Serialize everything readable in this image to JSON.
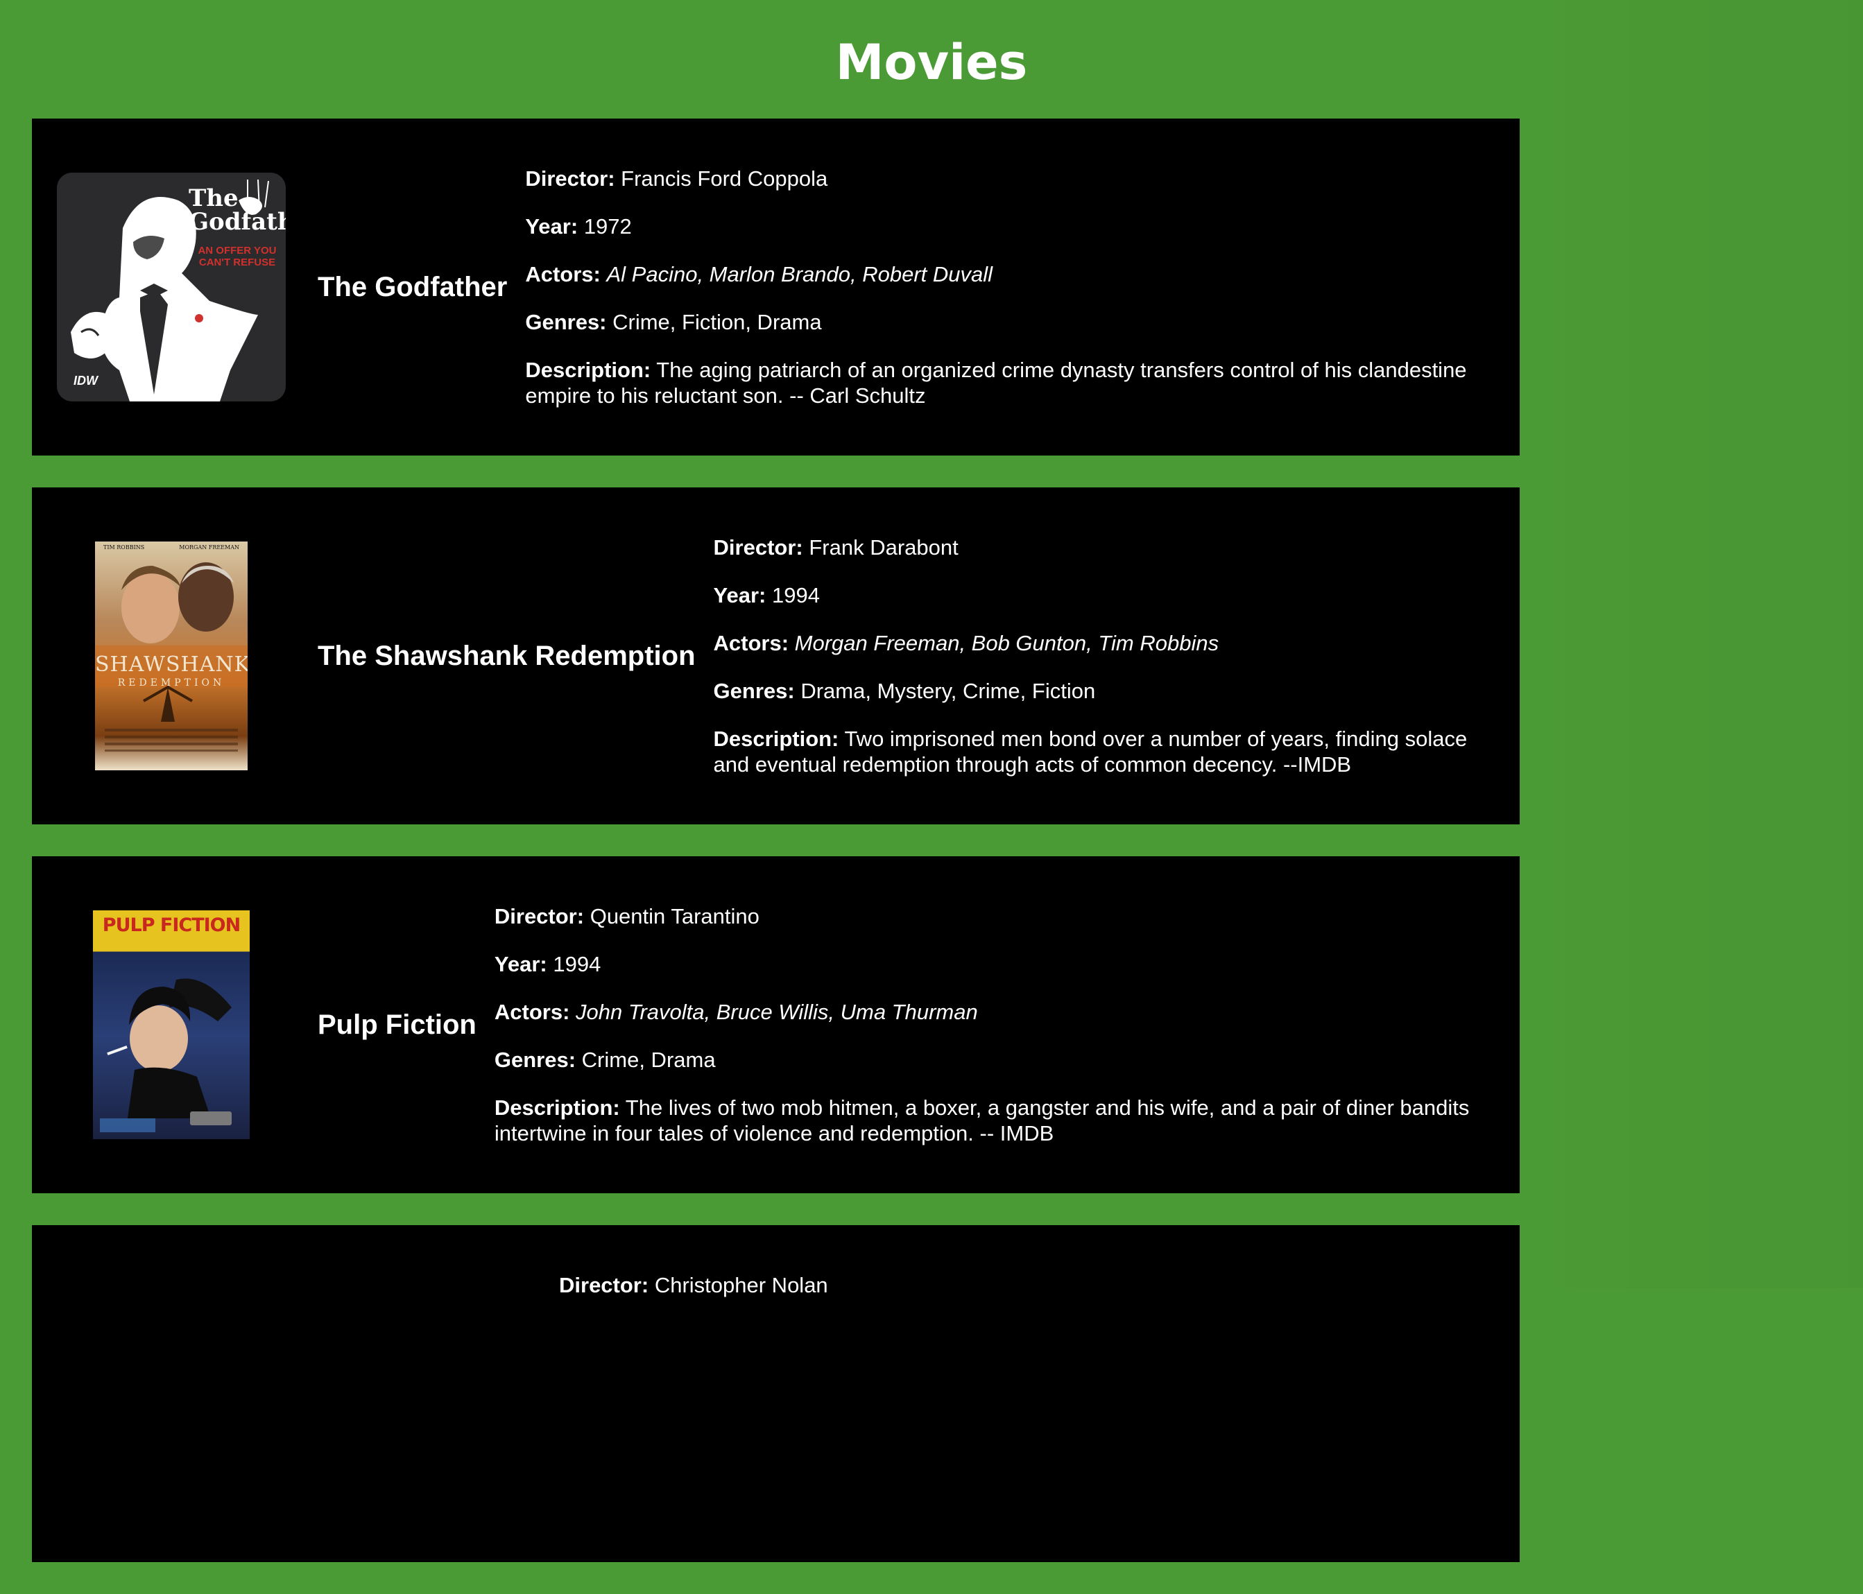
{
  "page": {
    "title": "Movies",
    "background_color": "#4a9a35",
    "card_color": "#000000"
  },
  "labels": {
    "director": "Director:",
    "year": "Year:",
    "actors": "Actors:",
    "genres": "Genres:",
    "description": "Description:"
  },
  "movies": [
    {
      "title": "The Godfather",
      "director": "Francis Ford Coppola",
      "year": "1972",
      "actors": "Al Pacino, Marlon Brando, Robert Duvall",
      "genres": "Crime, Fiction, Drama",
      "description": "The aging patriarch of an organized crime dynasty transfers control of his clandestine empire to his reluctant son. -- Carl Schultz",
      "poster": {
        "title_text": "The Godfather",
        "tagline": "AN OFFER YOU CAN'T REFUSE",
        "publisher": "IDW"
      }
    },
    {
      "title": "The Shawshank Redemption",
      "director": "Frank Darabont",
      "year": "1994",
      "actors": "Morgan Freeman, Bob Gunton, Tim Robbins",
      "genres": "Drama, Mystery, Crime, Fiction",
      "description": "Two imprisoned men bond over a number of years, finding solace and eventual redemption through acts of common decency. --IMDB",
      "poster": {
        "top_left": "TIM ROBBINS",
        "top_right": "MORGAN FREEMAN",
        "title_text": "SHAWSHANK",
        "subtitle": "REDEMPTION"
      }
    },
    {
      "title": "Pulp Fiction",
      "director": "Quentin Tarantino",
      "year": "1994",
      "actors": "John Travolta, Bruce Willis, Uma Thurman",
      "genres": "Crime, Drama",
      "description": "The lives of two mob hitmen, a boxer, a gangster and his wife, and a pair of diner bandits intertwine in four tales of violence and redemption. -- IMDB",
      "poster": {
        "title_text": "PULP FICTION"
      }
    },
    {
      "director": "Christopher Nolan"
    }
  ]
}
